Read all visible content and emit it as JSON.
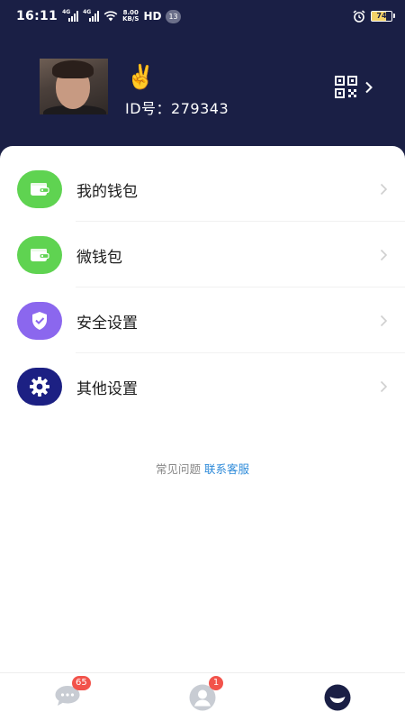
{
  "status_bar": {
    "time": "16:11",
    "network_1": "4G",
    "network_2": "4G",
    "speed_value": "8.00",
    "speed_unit": "KB/S",
    "hd": "HD",
    "notification_count": "13",
    "battery": "74"
  },
  "profile": {
    "emoji": "✌️",
    "id_label": "ID号：",
    "id_value": "279343"
  },
  "menu": {
    "items": [
      {
        "label": "我的钱包",
        "icon": "wallet-icon",
        "color": "#5fd351"
      },
      {
        "label": "微钱包",
        "icon": "wallet-icon",
        "color": "#5fd351"
      },
      {
        "label": "安全设置",
        "icon": "shield-check-icon",
        "color": "#8b67ee"
      },
      {
        "label": "其他设置",
        "icon": "gear-icon",
        "color": "#1c2083"
      }
    ]
  },
  "footer": {
    "faq": "常见问题",
    "contact": "联系客服"
  },
  "bottom_nav": {
    "messages_badge": "65",
    "contacts_badge": "1"
  },
  "colors": {
    "header_bg": "#1a1f45",
    "green": "#5fd351",
    "purple": "#8b67ee",
    "navy": "#1c2083",
    "link_blue": "#2d8ad9",
    "badge_red": "#f2534b"
  }
}
